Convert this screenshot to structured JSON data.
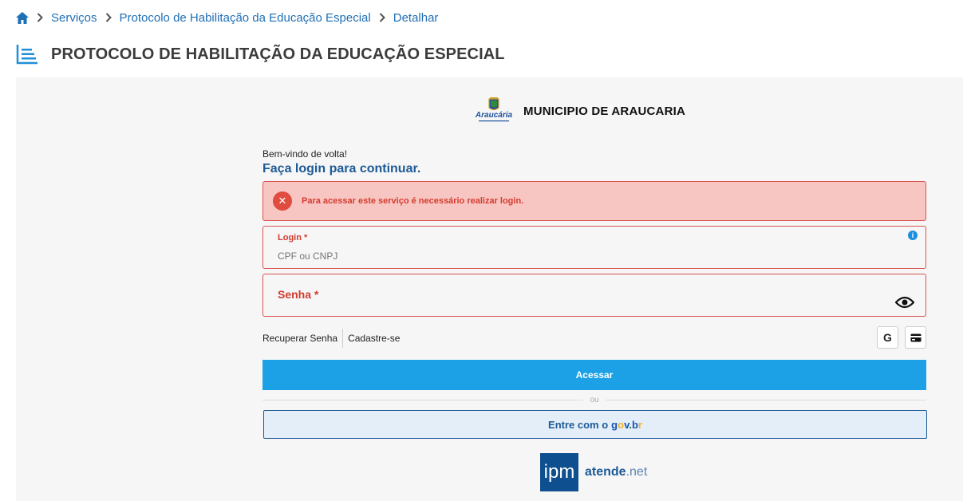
{
  "breadcrumb": {
    "items": [
      "Serviços",
      "Protocolo de Habilitação da Educação Especial",
      "Detalhar"
    ]
  },
  "page": {
    "title": "PROTOCOLO DE HABILITAÇÃO DA EDUCAÇÃO ESPECIAL"
  },
  "org": {
    "logo_text": "Araucária",
    "name": "MUNICIPIO DE ARAUCARIA"
  },
  "login": {
    "welcome": "Bem-vindo de volta!",
    "title": "Faça login para continuar.",
    "alert": "Para acessar este serviço é necessário realizar login.",
    "login_label": "Login *",
    "login_placeholder": "CPF ou CNPJ",
    "password_label": "Senha *",
    "recover_link": "Recuperar Senha",
    "register_link": "Cadastre-se",
    "google_label": "G",
    "submit_label": "Acessar",
    "or_label": "ou",
    "govbr_prefix": "Entre com o",
    "govbr_brand": "gov.br"
  },
  "footer": {
    "ipm": "ipm",
    "brand_main": "atende",
    "brand_suffix": ".net"
  },
  "colors": {
    "primary": "#1ca1e6",
    "title_blue": "#1d5a96",
    "error_red": "#d33b2f",
    "alert_bg": "#f8c6c2"
  }
}
